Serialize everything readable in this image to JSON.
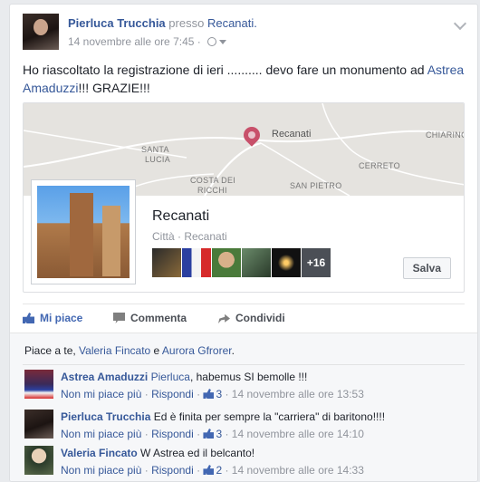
{
  "header": {
    "author": "Pierluca Trucchia",
    "presso": "presso",
    "place": "Recanati.",
    "timestamp": "14 novembre alle ore 7:45 ·"
  },
  "post": {
    "text_before": "Ho riascoltato la registrazione di ieri .......... devo fare un monumento ad ",
    "mention": "Astrea Amaduzzi",
    "text_after": "!!! GRAZIE!!!"
  },
  "map": {
    "city": "Recanati",
    "labels": {
      "santa_lucia_1": "SANTA",
      "santa_lucia_2": "LUCIA",
      "costa_1": "COSTA DEI",
      "costa_2": "RICCHI",
      "san_pietro": "SAN PIETRO",
      "cerreto": "CERRETO",
      "chiarino": "CHIARINO"
    }
  },
  "place_card": {
    "name": "Recanati",
    "subtitle": "Città · Recanati",
    "more_count": "+16",
    "save_label": "Salva"
  },
  "actions": {
    "like": "Mi piace",
    "comment": "Commenta",
    "share": "Condividi"
  },
  "likes_line": {
    "prefix": "Piace a te, ",
    "user1": "Valeria Fincato",
    "joiner": " e ",
    "user2": "Aurora Gfrorer",
    "suffix": "."
  },
  "comments": [
    {
      "author": "Astrea Amaduzzi",
      "mention": "Pierluca",
      "text": ", habemus SI bemolle !!!",
      "unlike": "Non mi piace più",
      "reply": "Rispondi",
      "likes": "3",
      "time": "14 novembre alle ore 13:53"
    },
    {
      "author": "Pierluca Trucchia",
      "mention": "",
      "text": "Ed è finita per sempre la \"carriera\" di baritono!!!!",
      "unlike": "Non mi piace più",
      "reply": "Rispondi",
      "likes": "3",
      "time": "14 novembre alle ore 14:10"
    },
    {
      "author": "Valeria Fincato",
      "mention": "",
      "text": "W Astrea ed il belcanto!",
      "unlike": "Non mi piace più",
      "reply": "Rispondi",
      "likes": "2",
      "time": "14 novembre alle ore 14:33"
    }
  ],
  "colors": {
    "link": "#365899",
    "like_blue": "#4267b2",
    "meta_gray": "#90949c",
    "pin": "#c8506a"
  }
}
